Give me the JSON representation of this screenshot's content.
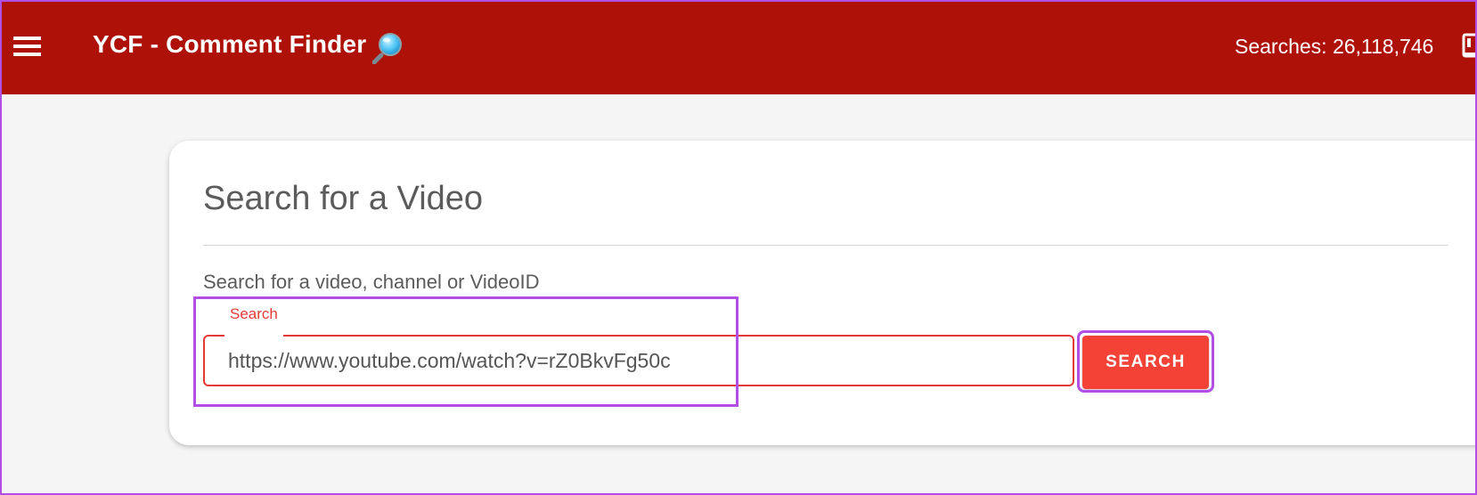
{
  "appbar": {
    "title": "YCF - Comment Finder",
    "title_icon": "magnifier-icon",
    "menu_icon": "hamburger-menu-icon",
    "search_count": "Searches: 26,118,746",
    "right_icon": "account-icon",
    "background_color": "#ad1108"
  },
  "card": {
    "title": "Search for a Video",
    "helper_text": "Search for a video, channel or VideoID",
    "input": {
      "label": "Search",
      "value": "https://www.youtube.com/watch?v=rZ0BkvFg50c",
      "accent_color": "#e53935"
    },
    "search_button": {
      "label": "SEARCH",
      "color": "#f44336"
    }
  },
  "annotation": {
    "highlight_color": "#b04ee6"
  }
}
